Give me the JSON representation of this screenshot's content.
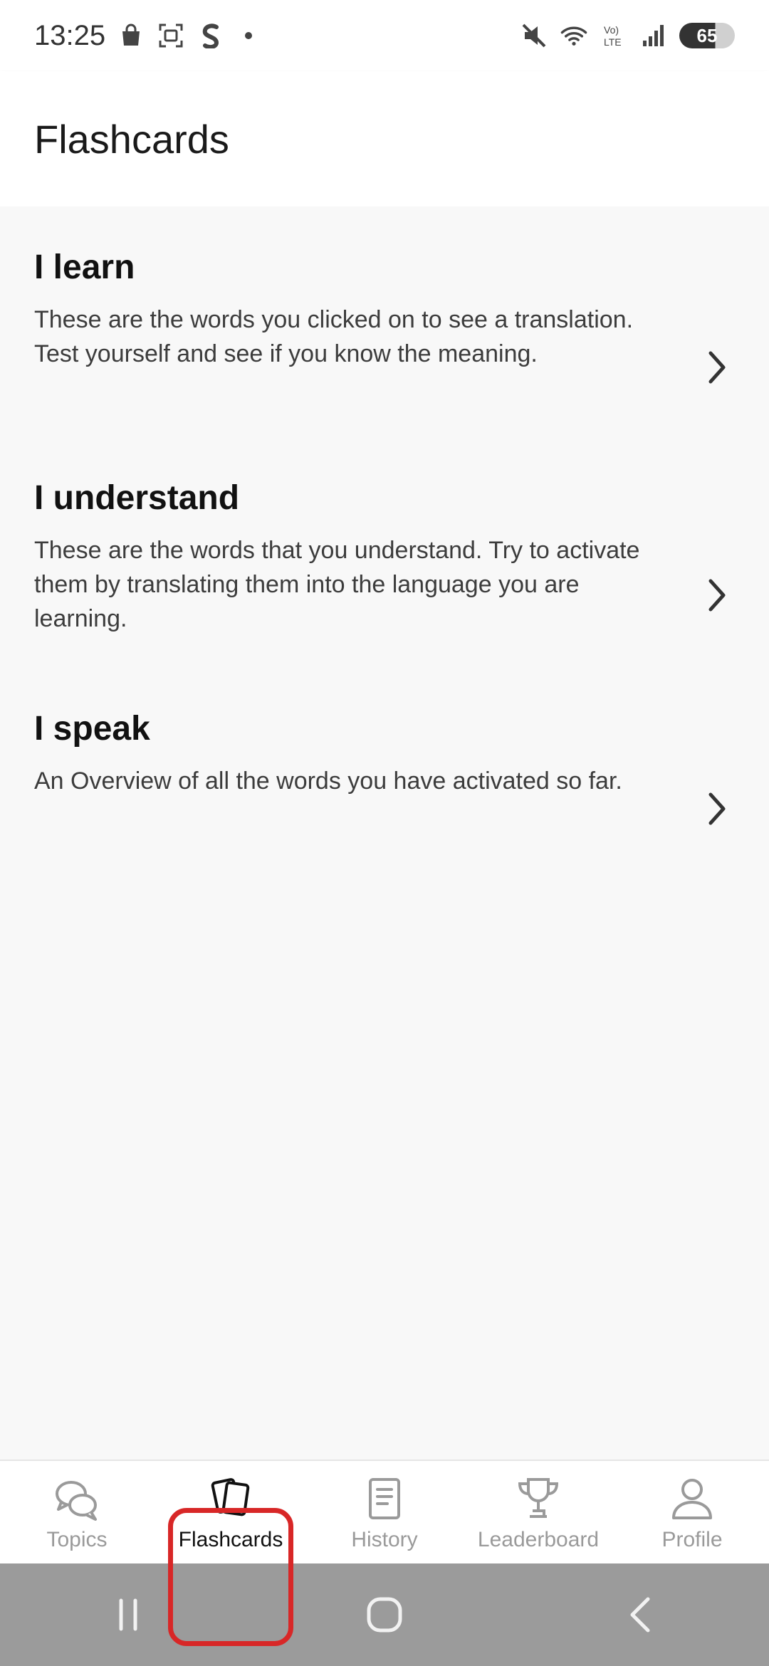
{
  "status_bar": {
    "time": "13:25",
    "battery": "65",
    "icons": [
      "shopping-bag-icon",
      "screenshot-icon",
      "app-s-icon",
      "mute-icon",
      "wifi-icon",
      "volte-icon",
      "signal-icon",
      "battery-icon"
    ]
  },
  "header": {
    "title": "Flashcards"
  },
  "sections": [
    {
      "title": "I learn",
      "description": "These are the words you clicked on to see a translation. Test yourself and see if you know the meaning."
    },
    {
      "title": "I understand",
      "description": "These are the words that you understand. Try to activate them by translating them into the language you are learning."
    },
    {
      "title": "I speak",
      "description": "An Overview of all the words you have activated so far."
    }
  ],
  "tabs": [
    {
      "label": "Topics",
      "icon": "chat-bubbles-icon",
      "active": false
    },
    {
      "label": "Flashcards",
      "icon": "cards-icon",
      "active": true
    },
    {
      "label": "History",
      "icon": "document-icon",
      "active": false
    },
    {
      "label": "Leaderboard",
      "icon": "trophy-icon",
      "active": false
    },
    {
      "label": "Profile",
      "icon": "person-icon",
      "active": false
    }
  ],
  "colors": {
    "highlight": "#d82727",
    "nav_bar": "#9b9b9b"
  }
}
